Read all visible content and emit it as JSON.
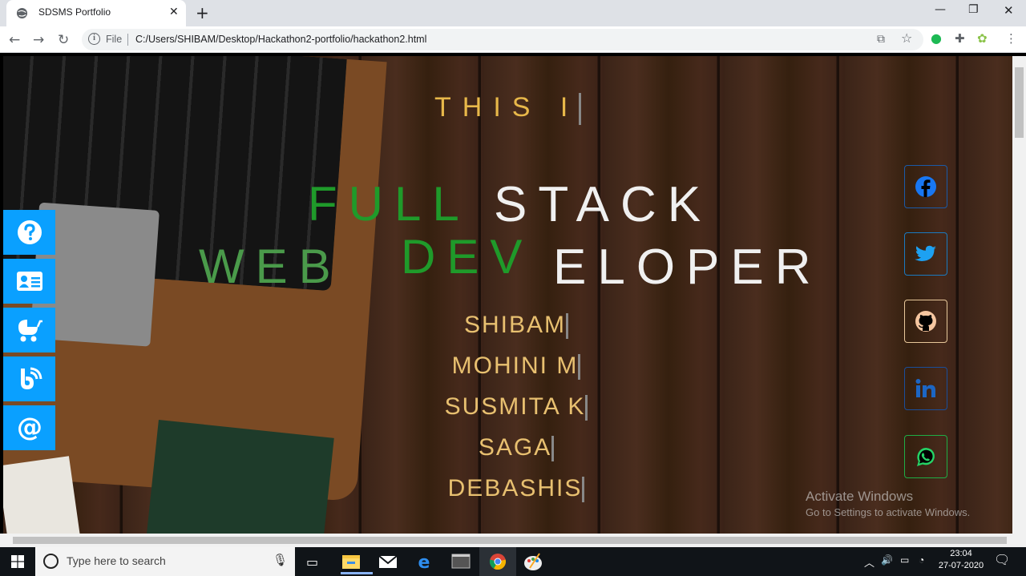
{
  "browser": {
    "tab_title": "SDSMS Portfolio",
    "tab_close": "✕",
    "new_tab": "+",
    "file_label": "File",
    "url": "C:/Users/SHIBAM/Desktop/Hackathon2-portfolio/hackathon2.html",
    "window_controls": [
      "—",
      "❐",
      "✕"
    ]
  },
  "hero": {
    "intro_text": "THIS I",
    "line1_green": "FULL",
    "line1_white": "STACK",
    "line2_web": "WEB",
    "line2_dev": "DEV",
    "line2_rest": "ELOPER"
  },
  "names": [
    "SHIBAM",
    "MOHINI M",
    "SUSMITA K",
    "SAGA",
    "DEBASHIS"
  ],
  "sidebar": {
    "items": [
      {
        "icon": "question-icon"
      },
      {
        "icon": "contact-card-icon"
      },
      {
        "icon": "baby-carriage-icon"
      },
      {
        "icon": "blog-icon"
      },
      {
        "icon": "at-icon"
      }
    ],
    "color": "#0aa0ff"
  },
  "socials": [
    {
      "icon": "facebook-icon",
      "color": "#1877f2"
    },
    {
      "icon": "twitter-icon",
      "color": "#1da1f2"
    },
    {
      "icon": "github-icon",
      "color": "#f5c6a0"
    },
    {
      "icon": "linkedin-icon",
      "color": "#1c66c4"
    },
    {
      "icon": "whatsapp-icon",
      "color": "#25d366"
    }
  ],
  "watermark": {
    "line1": "Activate Windows",
    "line2": "Go to Settings to activate Windows."
  },
  "taskbar": {
    "search_placeholder": "Type here to search",
    "time": "23:04",
    "date": "27-07-2020"
  },
  "colors": {
    "intro": "#e8b84a",
    "green": "#1f9a2a",
    "names": "#e8c070"
  }
}
